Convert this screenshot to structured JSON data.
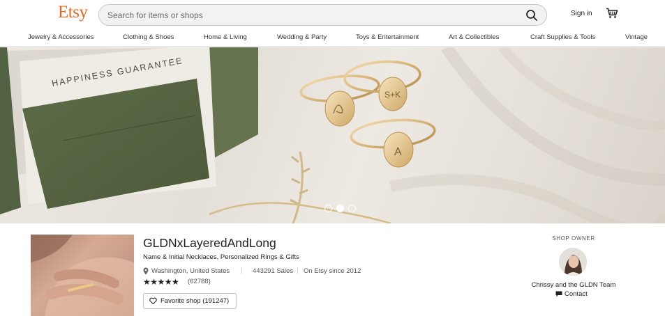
{
  "header": {
    "logo": "Etsy",
    "search_placeholder": "Search for items or shops",
    "signin_label": "Sign in"
  },
  "nav": {
    "items": [
      "Jewelry & Accessories",
      "Clothing & Shoes",
      "Home & Living",
      "Wedding & Party",
      "Toys & Entertainment",
      "Art & Collectibles",
      "Craft Supplies & Tools",
      "Vintage"
    ]
  },
  "hero": {
    "card_text": "HAPPINESS GUARANTEE",
    "ring_engravings": [
      "S+K",
      "A"
    ],
    "slide_count": 3,
    "active_slide": 2
  },
  "shop": {
    "name": "GLDNxLayeredAndLong",
    "tagline": "Name & Initial Necklaces, Personalized Rings & Gifts",
    "location": "Washington, United States",
    "sales": "443291 Sales",
    "since": "On Etsy since 2012",
    "stars": "★★★★★",
    "rating": 5,
    "reviews": "(62788)",
    "favorite_label": "Favorite shop (191247)"
  },
  "owner": {
    "title": "SHOP OWNER",
    "name": "Chrissy and the GLDN Team",
    "contact_label": "Contact"
  },
  "colors": {
    "brand": "#F1641E",
    "text": "#222222"
  }
}
